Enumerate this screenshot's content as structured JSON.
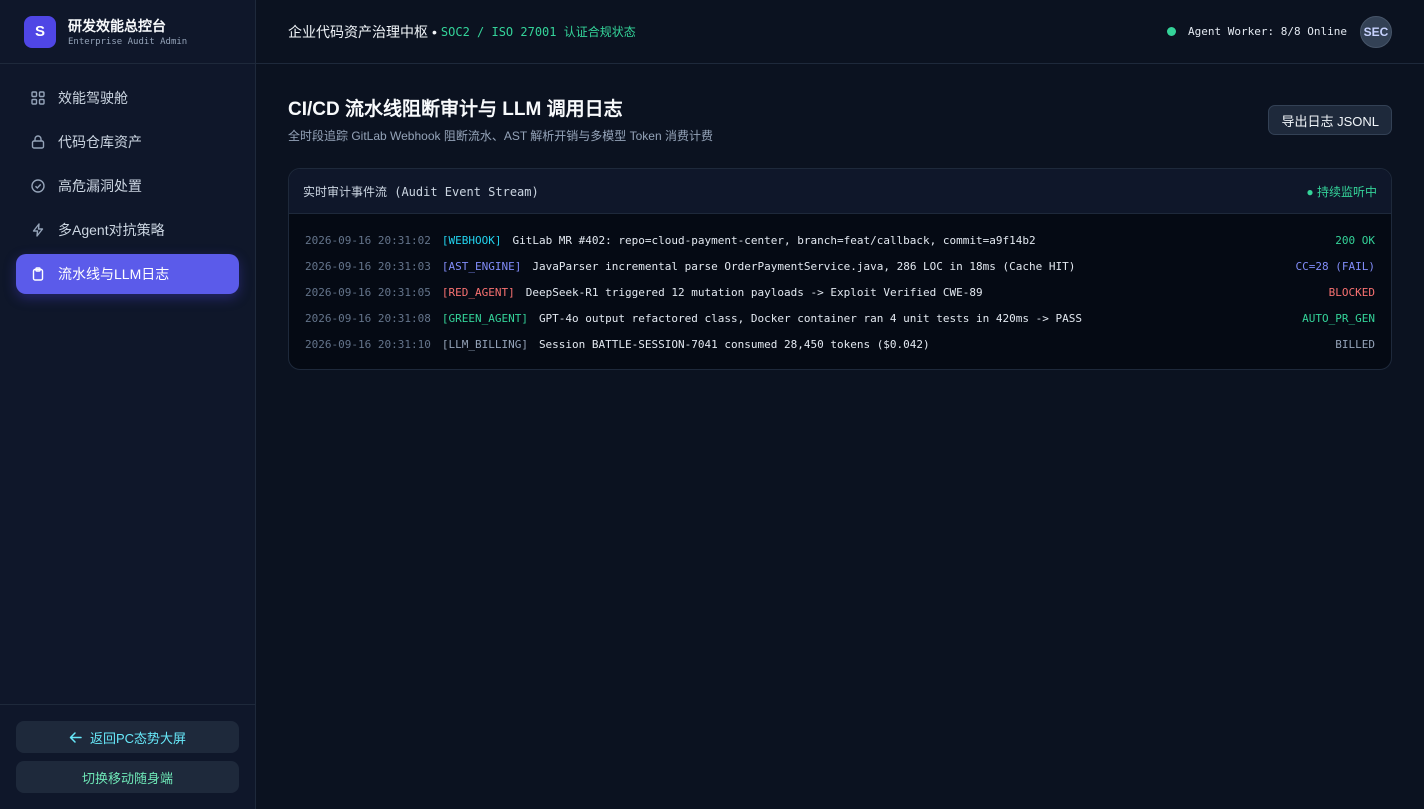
{
  "brand": {
    "logo": "S",
    "title": "研发效能总控台",
    "subtitle": "Enterprise Audit Admin"
  },
  "nav": [
    {
      "label": "效能驾驶舱",
      "icon": "grid-icon",
      "active": false
    },
    {
      "label": "代码仓库资产",
      "icon": "repository-icon",
      "active": false
    },
    {
      "label": "高危漏洞处置",
      "icon": "check-circle-icon",
      "active": false
    },
    {
      "label": "多Agent对抗策略",
      "icon": "lightning-icon",
      "active": false
    },
    {
      "label": "流水线与LLM日志",
      "icon": "clipboard-icon",
      "active": true
    }
  ],
  "sidebar_bottom": {
    "back_label": "返回PC态势大屏",
    "mobile_label": "切换移动随身端"
  },
  "topbar": {
    "title": "企业代码资产治理中枢",
    "separator": "•",
    "compliance": "SOC2 / ISO 27001 认证合规状态",
    "worker_status": "Agent Worker: 8/8 Online",
    "avatar": "SEC"
  },
  "page": {
    "title": "CI/CD 流水线阻断审计与 LLM 调用日志",
    "subtitle": "全时段追踪 GitLab Webhook 阻断流水、AST 解析开销与多模型 Token 消费计费",
    "export_label": "导出日志 JSONL"
  },
  "panel": {
    "title": "实时审计事件流 (Audit Event Stream)",
    "status": "● 持续监听中"
  },
  "logs": [
    {
      "ts": "2026-09-16 20:31:02",
      "source": "[WEBHOOK]",
      "source_color": "#22d3ee",
      "message": "GitLab MR #402: repo=cloud-payment-center, branch=feat/callback, commit=a9f14b2",
      "result": "200 OK",
      "result_color": "#34d399"
    },
    {
      "ts": "2026-09-16 20:31:03",
      "source": "[AST_ENGINE]",
      "source_color": "#818cf8",
      "message": "JavaParser incremental parse OrderPaymentService.java, 286 LOC in 18ms (Cache HIT)",
      "result": "CC=28 (FAIL)",
      "result_color": "#818cf8"
    },
    {
      "ts": "2026-09-16 20:31:05",
      "source": "[RED_AGENT]",
      "source_color": "#f87171",
      "message": "DeepSeek-R1 triggered 12 mutation payloads -> Exploit Verified CWE-89",
      "result": "BLOCKED",
      "result_color": "#f87171"
    },
    {
      "ts": "2026-09-16 20:31:08",
      "source": "[GREEN_AGENT]",
      "source_color": "#34d399",
      "message": "GPT-4o output refactored class, Docker container ran 4 unit tests in 420ms -> PASS",
      "result": "AUTO_PR_GEN",
      "result_color": "#34d399"
    },
    {
      "ts": "2026-09-16 20:31:10",
      "source": "[LLM_BILLING]",
      "source_color": "#94a3b8",
      "message": "Session BATTLE-SESSION-7041 consumed 28,450 tokens ($0.042)",
      "result": "BILLED",
      "result_color": "#94a3b8"
    }
  ]
}
